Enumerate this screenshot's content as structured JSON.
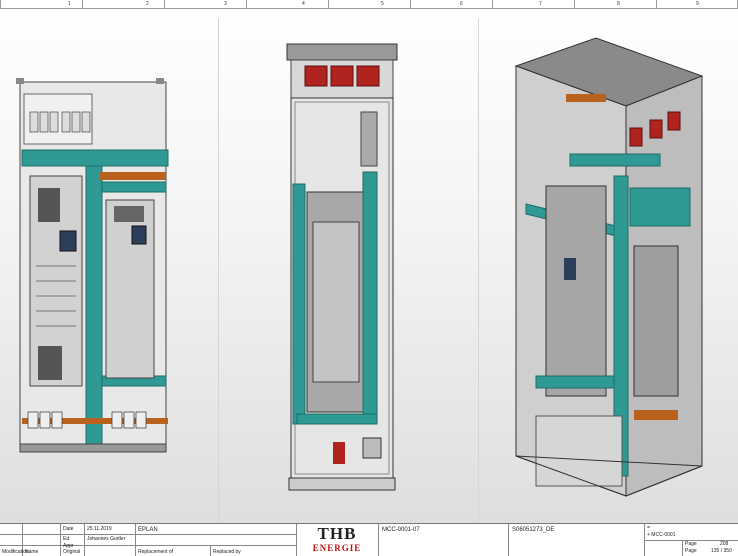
{
  "ruler": {
    "columns": [
      "1",
      "2",
      "3",
      "4",
      "5",
      "6",
      "7",
      "8",
      "9"
    ]
  },
  "titleblock": {
    "date_label": "Date",
    "date_value": "25.11.2019",
    "ed_label": "Ed",
    "ed_value": "Johannes Gurtler",
    "appr_label": "Appr",
    "name_label": "Name",
    "original_label": "Original",
    "modification_label": "Modification",
    "replacement_label": "Replacement of",
    "replaced_label": "Replaced by",
    "eplan": "EPLAN",
    "logo_main": "THB",
    "logo_sub": "ENERGIE",
    "drawing_no": "MCC-0001-07",
    "project_no": "S06051273_DE",
    "eq_symbol": "=",
    "location": "+ MCC-0001",
    "page_label": "Page",
    "page_value": "208",
    "page_of_label": "Page",
    "page_of_value": "135 / 350"
  },
  "colors": {
    "teal": "#2e9a93",
    "copper": "#b8621e",
    "red": "#b0231f",
    "steel": "#c8c8c8",
    "dark": "#333333"
  }
}
